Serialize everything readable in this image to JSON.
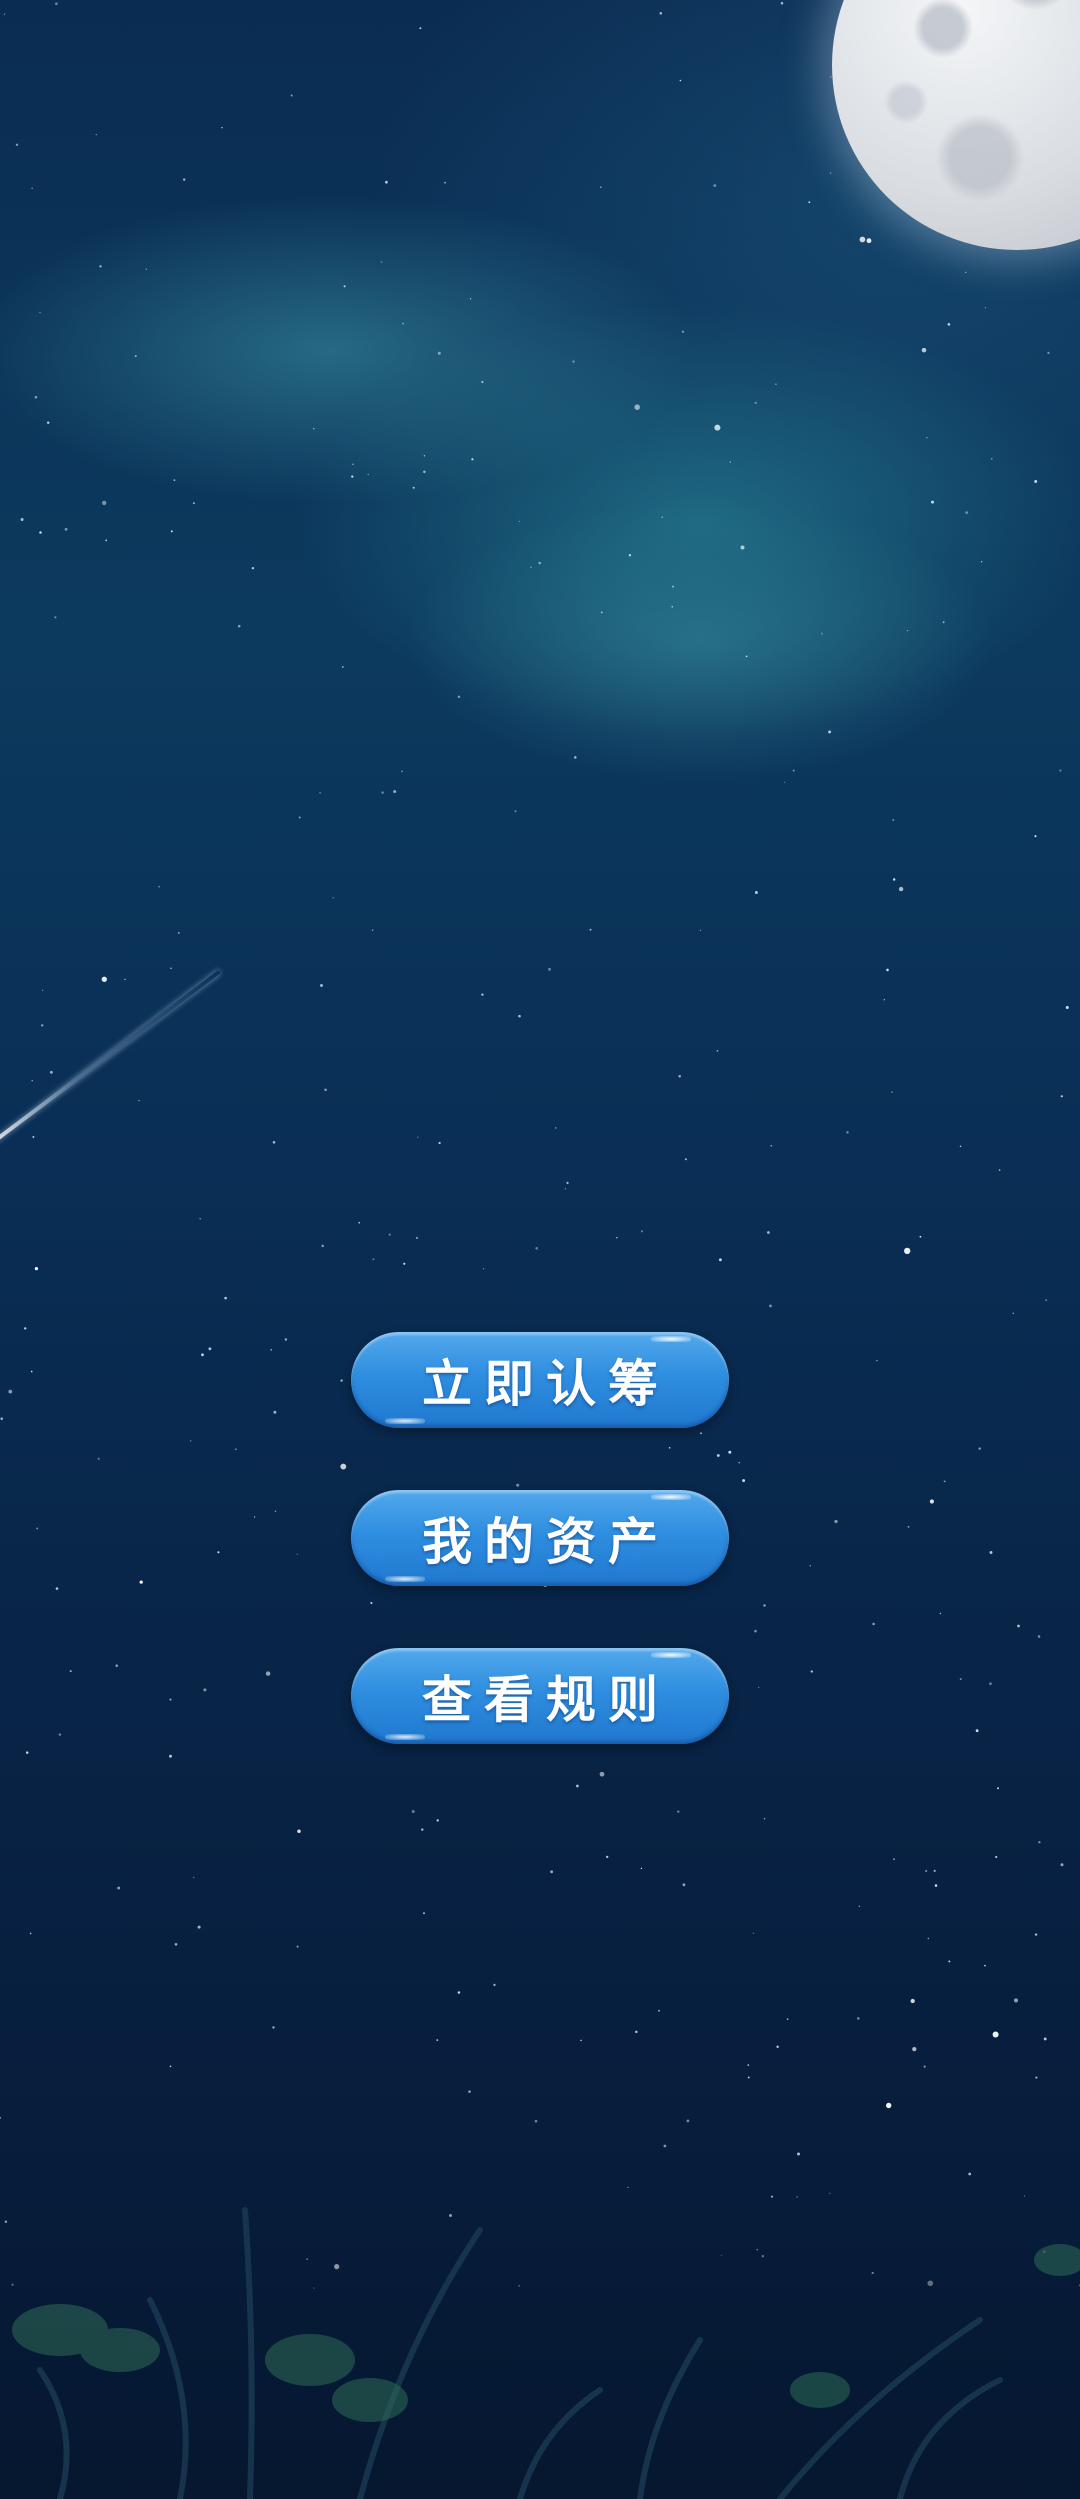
{
  "background": {
    "sky_top_color": "#0b2c52",
    "sky_bottom_color": "#061833",
    "cloud_color": "#2f8c9e",
    "moon_color": "#e6e9ee"
  },
  "menu": {
    "accent_color": "#2f8ee0",
    "subscribe_label": "立即认筹",
    "my_assets_label": "我的资产",
    "view_rules_label": "查看规则"
  }
}
